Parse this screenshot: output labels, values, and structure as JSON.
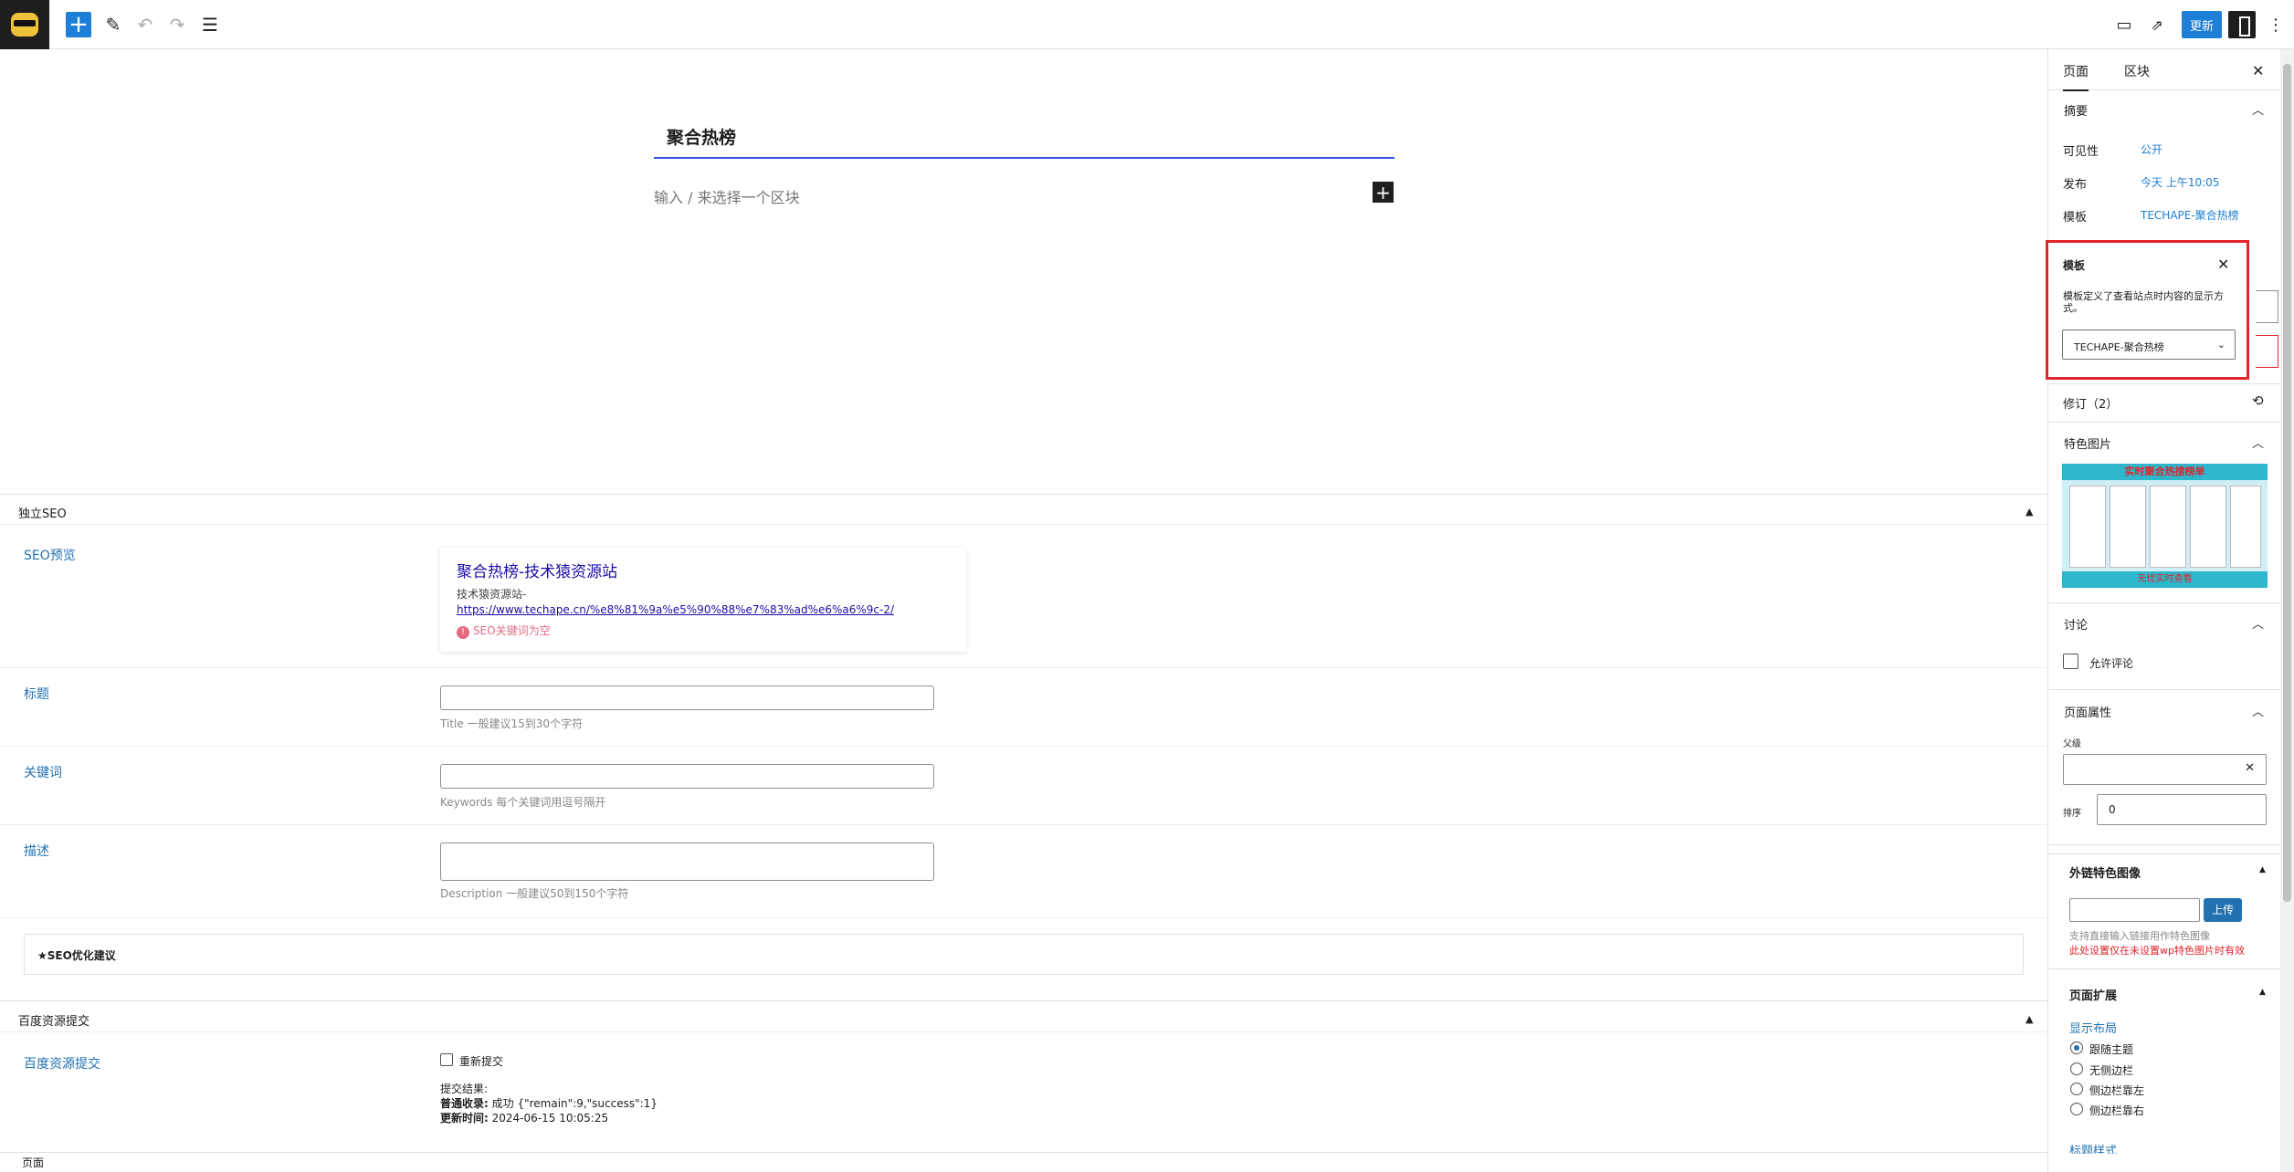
{
  "toolbar": {
    "update_label": "更新"
  },
  "editor": {
    "title": "聚合热榜",
    "block_placeholder": "输入 / 来选择一个区块"
  },
  "seo_box": {
    "header": "独立SEO",
    "preview_label": "SEO预览",
    "preview_title": "聚合热榜-技术猿资源站",
    "preview_site": "技术猿资源站-",
    "preview_url": "https://www.techape.cn/%e8%81%9a%e5%90%88%e7%83%ad%e6%a6%9c-2/",
    "preview_warning": "SEO关键词为空",
    "title_label": "标题",
    "title_hint": "Title 一般建议15到30个字符",
    "keywords_label": "关键词",
    "keywords_hint": "Keywords 每个关键词用逗号隔开",
    "desc_label": "描述",
    "desc_hint": "Description 一般建议50到150个字符",
    "suggest_label": "★SEO优化建议"
  },
  "baidu_box": {
    "header": "百度资源提交",
    "label": "百度资源提交",
    "resubmit": "重新提交",
    "result_label": "提交结果:",
    "normal_label": "普通收录:",
    "normal_value": "成功 {\"remain\":9,\"success\":1}",
    "update_label": "更新时间:",
    "update_value": "2024-06-15 10:05:25"
  },
  "statusbar": {
    "breadcrumb": "页面"
  },
  "sidebar": {
    "tab_page": "页面",
    "tab_block": "区块",
    "summary": "摘要",
    "visibility_label": "可见性",
    "visibility_value": "公开",
    "publish_label": "发布",
    "publish_value": "今天 上午10:05",
    "template_label": "模板",
    "template_value": "TECHAPE-聚合热榜",
    "revisions": "修订（2）",
    "featured_image": "特色图片",
    "thumb_header": "实时聚合热搜榜单",
    "thumb_footer": "无忧实时查看",
    "discussion": "讨论",
    "allow_comments": "允许评论",
    "page_attributes": "页面属性",
    "parent_label": "父级",
    "order_label": "排序",
    "order_value": "0",
    "ext_image_header": "外链特色图像",
    "upload_button": "上传",
    "ext_hint1": "支持直接输入链接用作特色图像",
    "ext_hint2": "此处设置仅在未设置wp特色图片时有效",
    "page_ext_header": "页面扩展",
    "layout_label": "显示布局",
    "layout_options": [
      "跟随主题",
      "无侧边栏",
      "侧边栏靠左",
      "侧边栏靠右"
    ],
    "title_style_label": "标题样式"
  },
  "template_popover": {
    "title": "模板",
    "description": "模板定义了查看站点时内容的显示方式。",
    "select_value": "TECHAPE-聚合热榜"
  },
  "colors": {
    "accent": "#1e7fd6",
    "highlight_border": "#e0242b"
  }
}
